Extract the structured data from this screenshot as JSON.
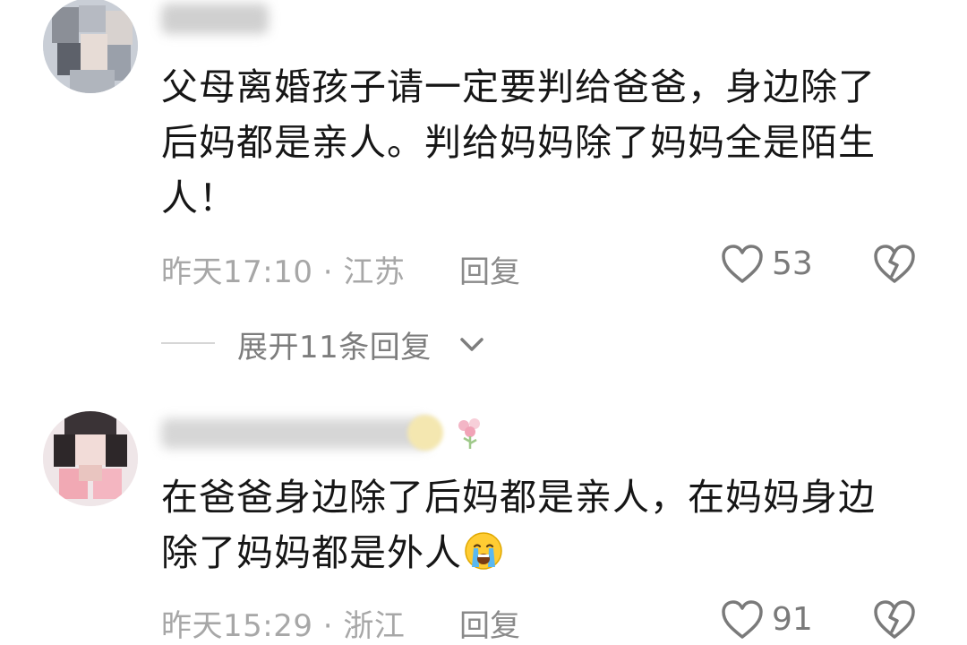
{
  "comments": [
    {
      "text": "父母离婚孩子请一定要判给爸爸，身边除了后妈都是亲人。判给妈妈除了妈妈全是陌生人！",
      "time": "昨天17:10",
      "separator": "·",
      "location": "江苏",
      "reply_label": "回复",
      "likes": "53",
      "expand_label": "展开11条回复"
    },
    {
      "text": "在爸爸身边除了后妈都是亲人，在妈妈身边除了妈妈都是外人",
      "emoji": "crying-face",
      "time": "昨天15:29",
      "separator": "·",
      "location": "浙江",
      "reply_label": "回复",
      "likes": "91"
    }
  ],
  "icons": {
    "like": "heart-outline-icon",
    "dislike": "broken-heart-icon",
    "expand": "chevron-down-icon"
  },
  "colors": {
    "text": "#161616",
    "meta": "#a7a7a7",
    "icon": "#7a7a7a"
  }
}
